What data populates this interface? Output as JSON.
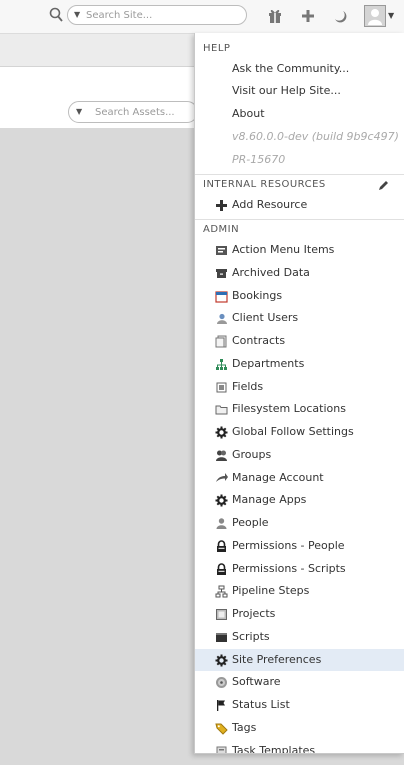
{
  "topbar": {
    "search_placeholder": "Search Site...",
    "icons": [
      "search-icon",
      "gift-icon",
      "plus-icon",
      "moon-icon",
      "user-avatar-icon",
      "chevron-down-icon"
    ]
  },
  "assets": {
    "search_placeholder": "Search Assets..."
  },
  "menu": {
    "help": {
      "header": "HELP",
      "items": [
        "Ask the Community...",
        "Visit our Help Site...",
        "About"
      ],
      "version": "v8.60.0.0-dev (build 9b9c497)",
      "pr": "PR-15670"
    },
    "internal": {
      "header": "INTERNAL RESOURCES",
      "add_label": "Add Resource"
    },
    "admin": {
      "header": "ADMIN",
      "items": [
        {
          "label": "Action Menu Items",
          "icon": "action-menu-icon"
        },
        {
          "label": "Archived Data",
          "icon": "archive-icon"
        },
        {
          "label": "Bookings",
          "icon": "calendar-icon"
        },
        {
          "label": "Client Users",
          "icon": "client-user-icon"
        },
        {
          "label": "Contracts",
          "icon": "contract-icon"
        },
        {
          "label": "Departments",
          "icon": "org-chart-icon"
        },
        {
          "label": "Fields",
          "icon": "field-icon"
        },
        {
          "label": "Filesystem Locations",
          "icon": "folder-icon"
        },
        {
          "label": "Global Follow Settings",
          "icon": "gear-icon"
        },
        {
          "label": "Groups",
          "icon": "group-icon"
        },
        {
          "label": "Manage Account",
          "icon": "arrow-icon"
        },
        {
          "label": "Manage Apps",
          "icon": "gear-icon"
        },
        {
          "label": "People",
          "icon": "person-icon"
        },
        {
          "label": "Permissions - People",
          "icon": "lock-icon"
        },
        {
          "label": "Permissions - Scripts",
          "icon": "lock-icon"
        },
        {
          "label": "Pipeline Steps",
          "icon": "pipeline-icon"
        },
        {
          "label": "Projects",
          "icon": "project-icon"
        },
        {
          "label": "Scripts",
          "icon": "script-icon"
        },
        {
          "label": "Site Preferences",
          "icon": "gear-icon",
          "highlighted": true
        },
        {
          "label": "Software",
          "icon": "software-icon"
        },
        {
          "label": "Status List",
          "icon": "flag-icon"
        },
        {
          "label": "Tags",
          "icon": "tag-icon"
        },
        {
          "label": "Task Templates",
          "icon": "template-icon"
        }
      ]
    }
  },
  "colors": {
    "highlight": "#e3ebf5",
    "link_blue": "#2f6fb5"
  }
}
